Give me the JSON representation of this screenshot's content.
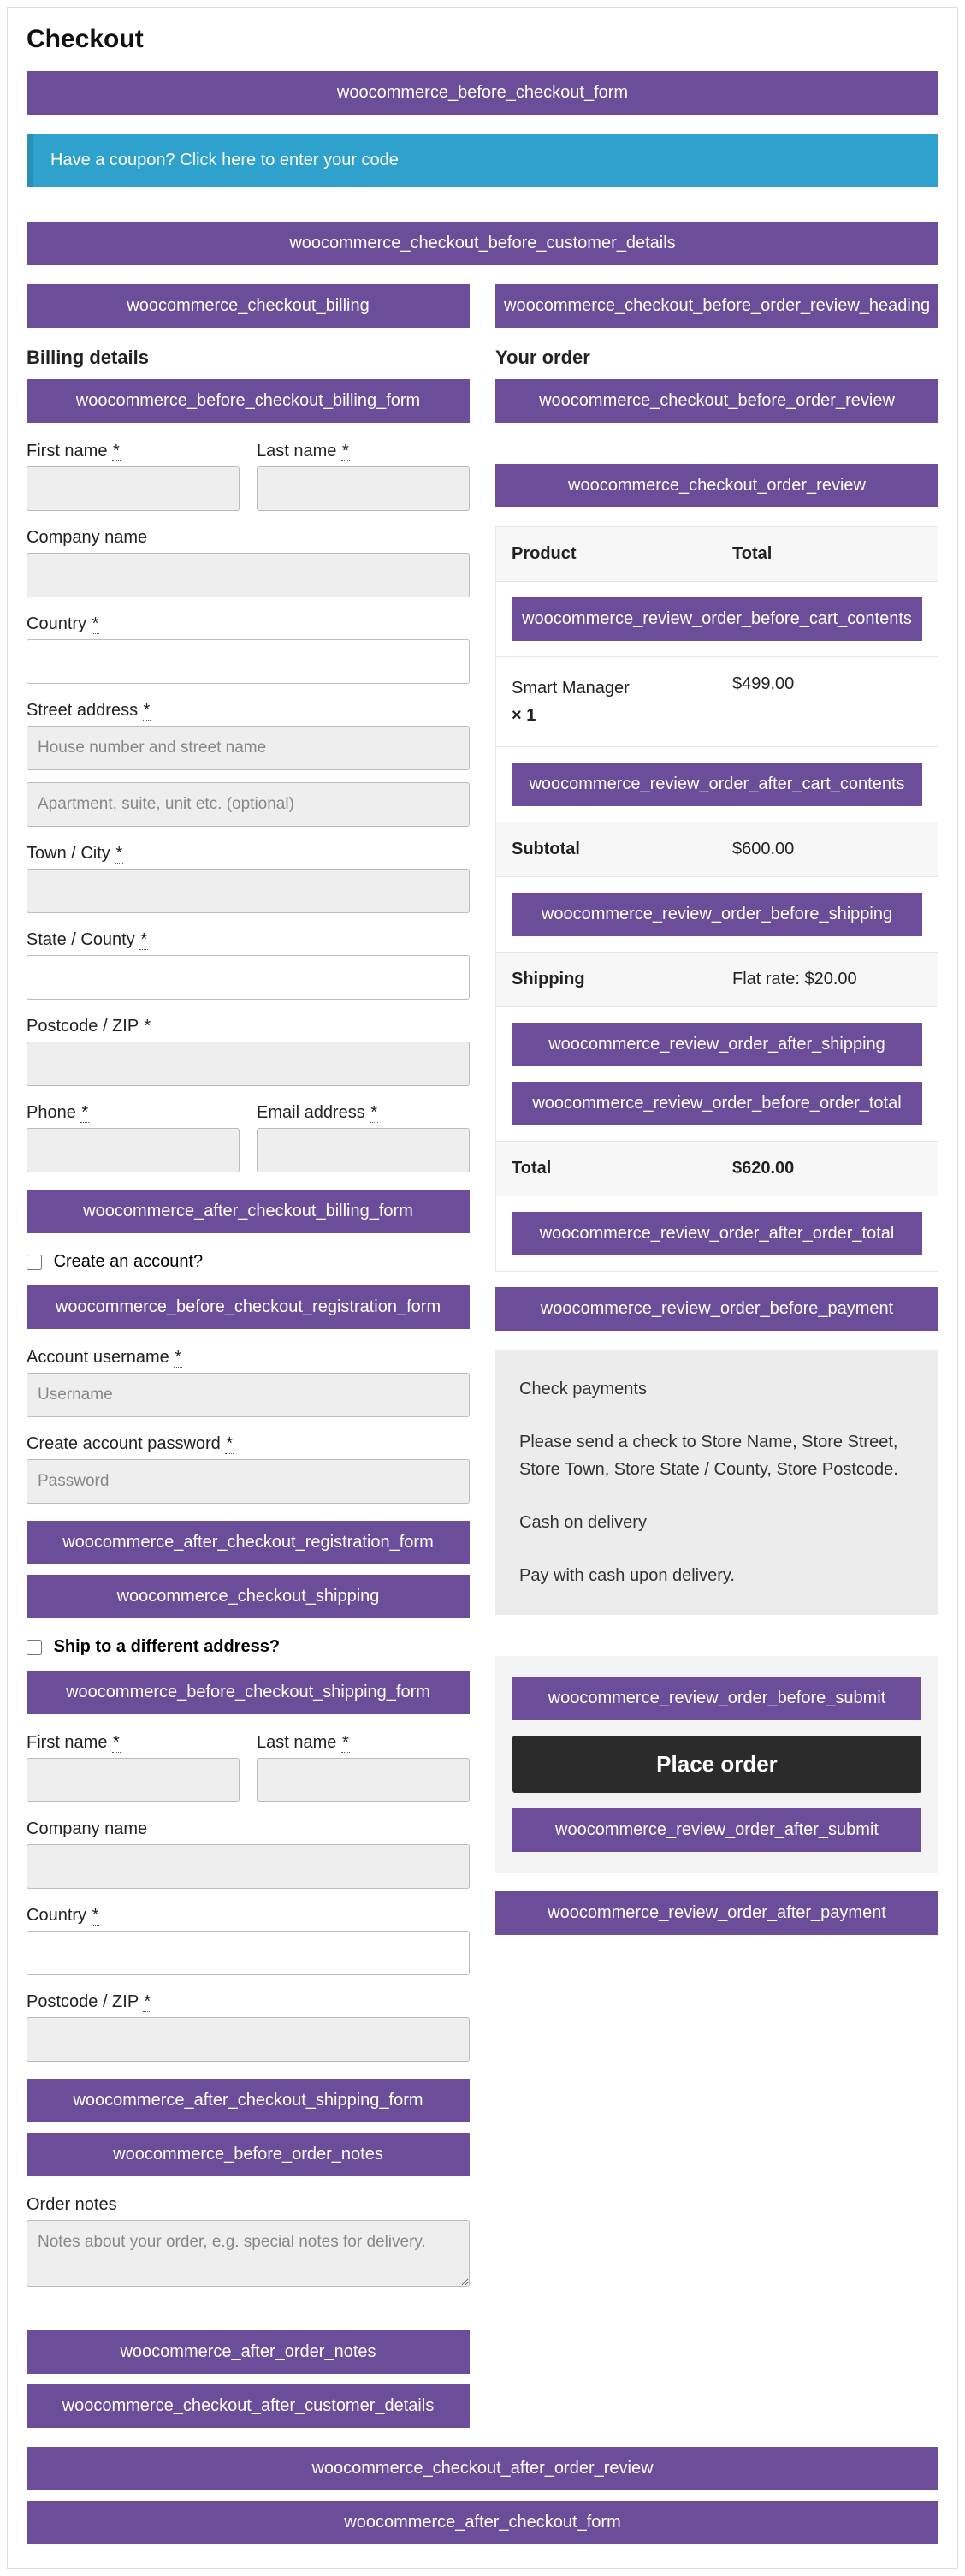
{
  "page_title": "Checkout",
  "hooks": {
    "before_checkout_form": "woocommerce_before_checkout_form",
    "before_customer_details": "woocommerce_checkout_before_customer_details",
    "checkout_billing": "woocommerce_checkout_billing",
    "before_billing_form": "woocommerce_before_checkout_billing_form",
    "after_billing_form": "woocommerce_after_checkout_billing_form",
    "before_registration_form": "woocommerce_before_checkout_registration_form",
    "after_registration_form": "woocommerce_after_checkout_registration_form",
    "checkout_shipping": "woocommerce_checkout_shipping",
    "before_shipping_form": "woocommerce_before_checkout_shipping_form",
    "after_shipping_form": "woocommerce_after_checkout_shipping_form",
    "before_order_notes": "woocommerce_before_order_notes",
    "after_order_notes": "woocommerce_after_order_notes",
    "after_customer_details": "woocommerce_checkout_after_customer_details",
    "before_order_review_heading": "woocommerce_checkout_before_order_review_heading",
    "before_order_review": "woocommerce_checkout_before_order_review",
    "order_review": "woocommerce_checkout_order_review",
    "review_before_cart_contents": "woocommerce_review_order_before_cart_contents",
    "review_after_cart_contents": "woocommerce_review_order_after_cart_contents",
    "review_before_shipping": "woocommerce_review_order_before_shipping",
    "review_after_shipping": "woocommerce_review_order_after_shipping",
    "review_before_order_total": "woocommerce_review_order_before_order_total",
    "review_after_order_total": "woocommerce_review_order_after_order_total",
    "review_before_payment": "woocommerce_review_order_before_payment",
    "review_before_submit": "woocommerce_review_order_before_submit",
    "review_after_submit": "woocommerce_review_order_after_submit",
    "review_after_payment": "woocommerce_review_order_after_payment",
    "after_order_review": "woocommerce_checkout_after_order_review",
    "after_checkout_form": "woocommerce_after_checkout_form"
  },
  "coupon_notice": "Have a coupon? Click here to enter your code",
  "billing": {
    "heading": "Billing details",
    "first_name": "First name",
    "last_name": "Last name",
    "company": "Company name",
    "country": "Country",
    "street": "Street address",
    "street_ph1": "House number and street name",
    "street_ph2": "Apartment, suite, unit etc. (optional)",
    "city": "Town / City",
    "state": "State / County",
    "postcode": "Postcode / ZIP",
    "phone": "Phone",
    "email": "Email address",
    "create_account": "Create an account?",
    "username_label": "Account username",
    "username_ph": "Username",
    "password_label": "Create account password",
    "password_ph": "Password"
  },
  "shipping": {
    "ship_different": "Ship to a different address?",
    "first_name": "First name",
    "last_name": "Last name",
    "company": "Company name",
    "country": "Country",
    "postcode": "Postcode / ZIP",
    "order_notes": "Order notes",
    "order_notes_ph": "Notes about your order, e.g. special notes for delivery."
  },
  "order": {
    "heading": "Your order",
    "th_product": "Product",
    "th_total": "Total",
    "item_name": "Smart Manager",
    "item_qty": "× 1",
    "item_total": "$499.00",
    "subtotal_label": "Subtotal",
    "subtotal_value": "$600.00",
    "shipping_label": "Shipping",
    "shipping_value": "Flat rate: $20.00",
    "total_label": "Total",
    "total_value": "$620.00"
  },
  "payment": {
    "check_title": "Check payments",
    "check_desc": "Please send a check to Store Name, Store Street, Store Town, Store State / County, Store Postcode.",
    "cod_title": "Cash on delivery",
    "cod_desc": "Pay with cash upon delivery.",
    "place_order": "Place order"
  },
  "star": "*"
}
